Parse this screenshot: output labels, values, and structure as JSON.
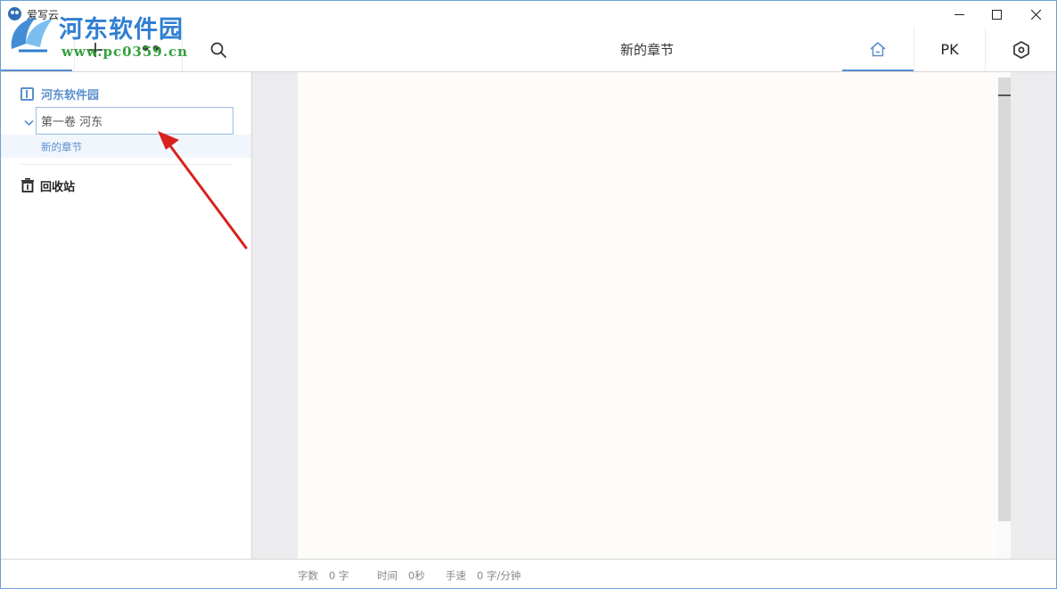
{
  "window": {
    "app_title": "爱写云"
  },
  "watermark": {
    "title": "河东软件园",
    "url": "www.pc0359.cn"
  },
  "toolbar": {
    "chapter_title": "新的章节",
    "pk_label": "PK",
    "more_label": "••"
  },
  "sidebar": {
    "book_name": "河东软件园",
    "volume_input_value": "第一卷 河东",
    "chapter_name": "新的章节",
    "trash_label": "回收站"
  },
  "statusbar": {
    "word_count_label": "字数",
    "word_count_value": "0 字",
    "time_label": "时间",
    "time_value": "0秒",
    "speed_label": "手速",
    "speed_value": "0 字/分钟"
  },
  "colors": {
    "accent": "#5a8fd0",
    "window_border": "#6d9fd6",
    "paper": "#fdfcf8",
    "editor_bg": "#ececee",
    "annotation_arrow": "#d9211e",
    "watermark_blue": "#2f7fd2",
    "watermark_green": "#33a13c"
  },
  "icons": [
    "app-owl-icon",
    "minimize-icon",
    "maximize-icon",
    "close-icon",
    "plus-icon",
    "search-icon",
    "home-icon",
    "settings-hex-icon",
    "book-icon",
    "chevron-down-icon",
    "trash-icon"
  ]
}
